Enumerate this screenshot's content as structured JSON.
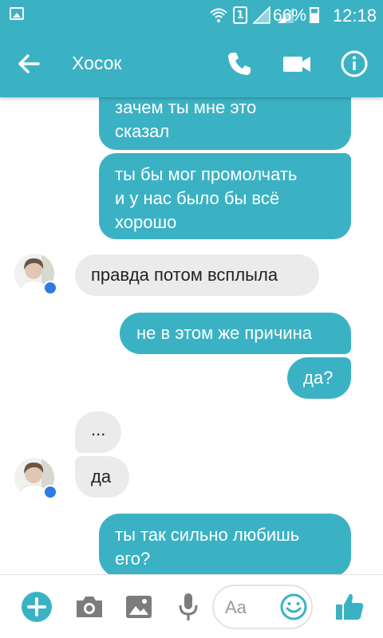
{
  "status_bar": {
    "sim_slot": "1",
    "battery": "66%",
    "time": "12:18"
  },
  "header": {
    "contact_name": "Хосок",
    "icons": [
      "back-arrow-icon",
      "phone-icon",
      "video-camera-icon",
      "info-icon"
    ]
  },
  "colors": {
    "accent": "#3bb2c4",
    "incoming_bubble": "#ebebeb",
    "messenger_badge": "#2d7be5"
  },
  "messages": [
    {
      "direction": "outgoing",
      "lines": [
        "зачем ты мне это",
        "сказал"
      ]
    },
    {
      "direction": "outgoing",
      "lines": [
        "ты бы мог промолчать",
        "и у нас было бы всё",
        "хорошо"
      ]
    },
    {
      "direction": "incoming",
      "lines": [
        "правда потом всплыла"
      ]
    },
    {
      "direction": "outgoing",
      "lines": [
        "не в этом же причина"
      ]
    },
    {
      "direction": "outgoing",
      "lines": [
        "да?"
      ]
    },
    {
      "direction": "incoming",
      "lines": [
        "..."
      ]
    },
    {
      "direction": "incoming",
      "lines": [
        "да"
      ]
    },
    {
      "direction": "outgoing",
      "lines": [
        "ты так сильно любишь",
        "его?"
      ]
    }
  ],
  "composer": {
    "placeholder": "Aa",
    "icons": [
      "add-icon",
      "camera-icon",
      "gallery-icon",
      "microphone-icon",
      "emoji-icon",
      "thumbs-up-icon"
    ]
  }
}
